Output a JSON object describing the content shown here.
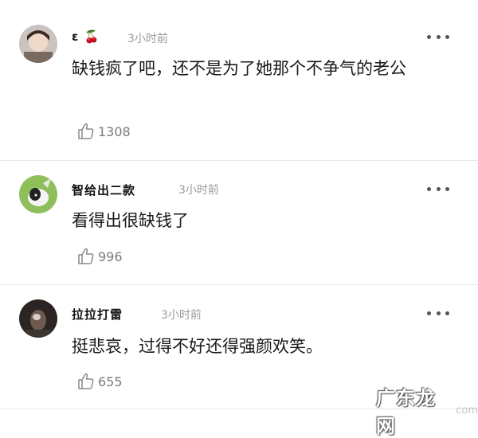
{
  "comments": [
    {
      "name": "ε 🍒",
      "time": "3小时前",
      "text": "缺钱疯了吧，还不是为了她那个不争气的老公",
      "likes": "1308"
    },
    {
      "name": "智给出二款",
      "time": "3小时前",
      "text": "看得出很缺钱了",
      "likes": "996"
    },
    {
      "name": "拉拉打雷",
      "time": "3小时前",
      "text": "挺悲哀，过得不好还得强颜欢笑。",
      "likes": "655"
    }
  ],
  "watermark": {
    "text": "广东龙网",
    "suffix": "com"
  }
}
